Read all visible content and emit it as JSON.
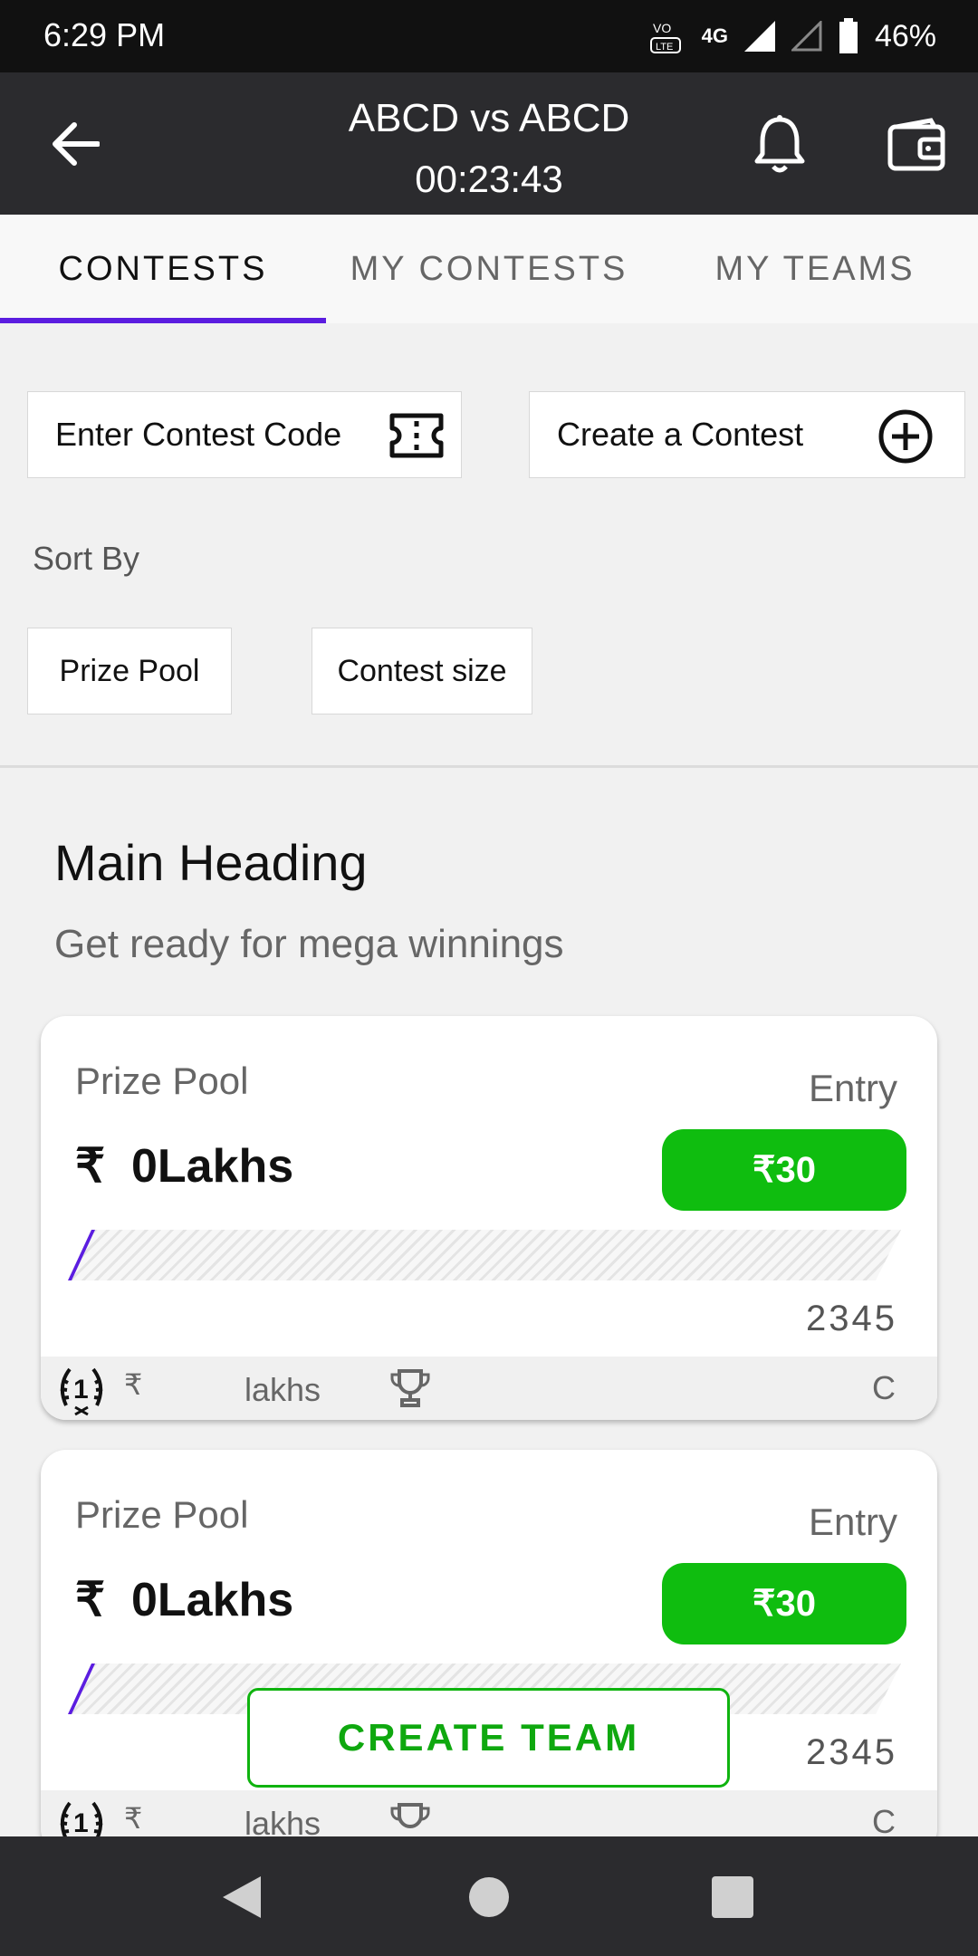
{
  "status_bar": {
    "time": "6:29 PM",
    "network": "4G",
    "volte": "VoLTE",
    "battery": "46%"
  },
  "app_bar": {
    "title": "ABCD vs ABCD",
    "timer": "00:23:43"
  },
  "tabs": [
    {
      "label": "CONTESTS",
      "active": true
    },
    {
      "label": "MY CONTESTS",
      "active": false
    },
    {
      "label": "MY TEAMS",
      "active": false
    }
  ],
  "actions": {
    "contest_code": "Enter Contest Code",
    "create_contest": "Create a Contest"
  },
  "sort": {
    "label": "Sort By",
    "options": [
      "Prize Pool",
      "Contest size"
    ]
  },
  "section": {
    "heading": "Main Heading",
    "subheading": "Get ready for mega winnings"
  },
  "contests": [
    {
      "prize_label": "Prize Pool",
      "entry_label": "Entry",
      "amount": "0Lakhs",
      "currency": "₹",
      "entry_fee": "₹30",
      "spots": "2345",
      "footer_currency": "₹",
      "footer_lakhs": "lakhs",
      "footer_c": "C",
      "fill_fraction": 0.02
    },
    {
      "prize_label": "Prize Pool",
      "entry_label": "Entry",
      "amount": "0Lakhs",
      "currency": "₹",
      "entry_fee": "₹30",
      "spots": "2345",
      "footer_currency": "₹",
      "footer_lakhs": "lakhs",
      "footer_c": "C",
      "fill_fraction": 0.02
    }
  ],
  "create_team": "CREATE TEAM",
  "colors": {
    "accent": "#5b1de0",
    "green": "#0fbd0f",
    "appbar": "#2b2b2e"
  },
  "icons": [
    "back-arrow-icon",
    "bell-icon",
    "wallet-icon",
    "ticket-icon",
    "plus-circle-icon",
    "laurel-rank-icon",
    "trophy-icon",
    "nav-back-icon",
    "nav-home-icon",
    "nav-recents-icon"
  ]
}
